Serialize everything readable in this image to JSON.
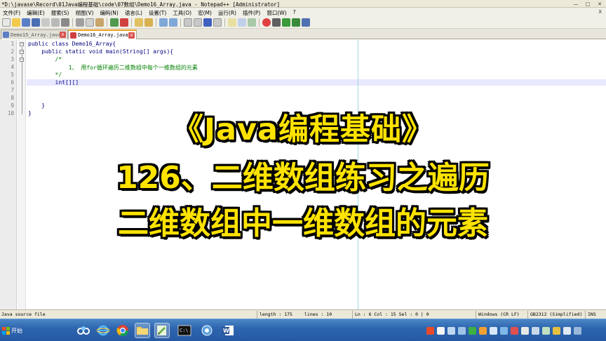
{
  "window": {
    "title": "*D:\\javase\\Record\\01Java编程基础\\code\\07数组\\Demo16_Array.java - Notepad++ [Administrator]",
    "buttons": [
      "—",
      "□",
      "✕"
    ]
  },
  "menu": [
    "文件(F)",
    "编辑(E)",
    "搜索(S)",
    "视图(V)",
    "编码(N)",
    "语言(L)",
    "设置(T)",
    "工具(O)",
    "宏(M)",
    "运行(R)",
    "插件(P)",
    "窗口(W)",
    "?"
  ],
  "menu_close": "X",
  "tabs": [
    {
      "label": "Demo15_Array.java",
      "active": false
    },
    {
      "label": "Demo16_Array.java",
      "active": true
    }
  ],
  "tab_close": "x",
  "code": {
    "line_numbers": [
      "1",
      "2",
      "3",
      "4",
      "5",
      "6",
      "7",
      "8",
      "9",
      "10"
    ],
    "lines": [
      "public class Demo16_Array{",
      "    public static void main(String[] args){",
      "        /*",
      "            1、 用for循环遍历二维数组中每个一维数组的元素",
      "        */",
      "        int[][]",
      "",
      "",
      "    }",
      "}"
    ]
  },
  "overlay": {
    "line1": "《Java编程基础》",
    "line2": "126、二维数组练习之遍历",
    "line3": "二维数组中一维数组的元素"
  },
  "statusbar": {
    "file_type": "Java source file",
    "length": "length : 175",
    "lines": "lines : 10",
    "position": "Ln : 6    Col : 15    Sel : 0 | 0",
    "eol": "Windows (CR LF)",
    "encoding": "GB2312 (Simplified)",
    "mode": "INS"
  },
  "taskbar": {
    "start_label": "开始",
    "apps": [
      "baidu-netdisk",
      "internet-explorer",
      "chrome",
      "file-explorer",
      "notepad-plus-plus",
      "command-prompt",
      "control-panel",
      "word"
    ]
  },
  "colors": {
    "overlay_text": "#ffe300",
    "overlay_outline": "#000000",
    "code_keyword": "#000080",
    "code_comment": "#008000",
    "taskbar": "#2f66b0"
  }
}
